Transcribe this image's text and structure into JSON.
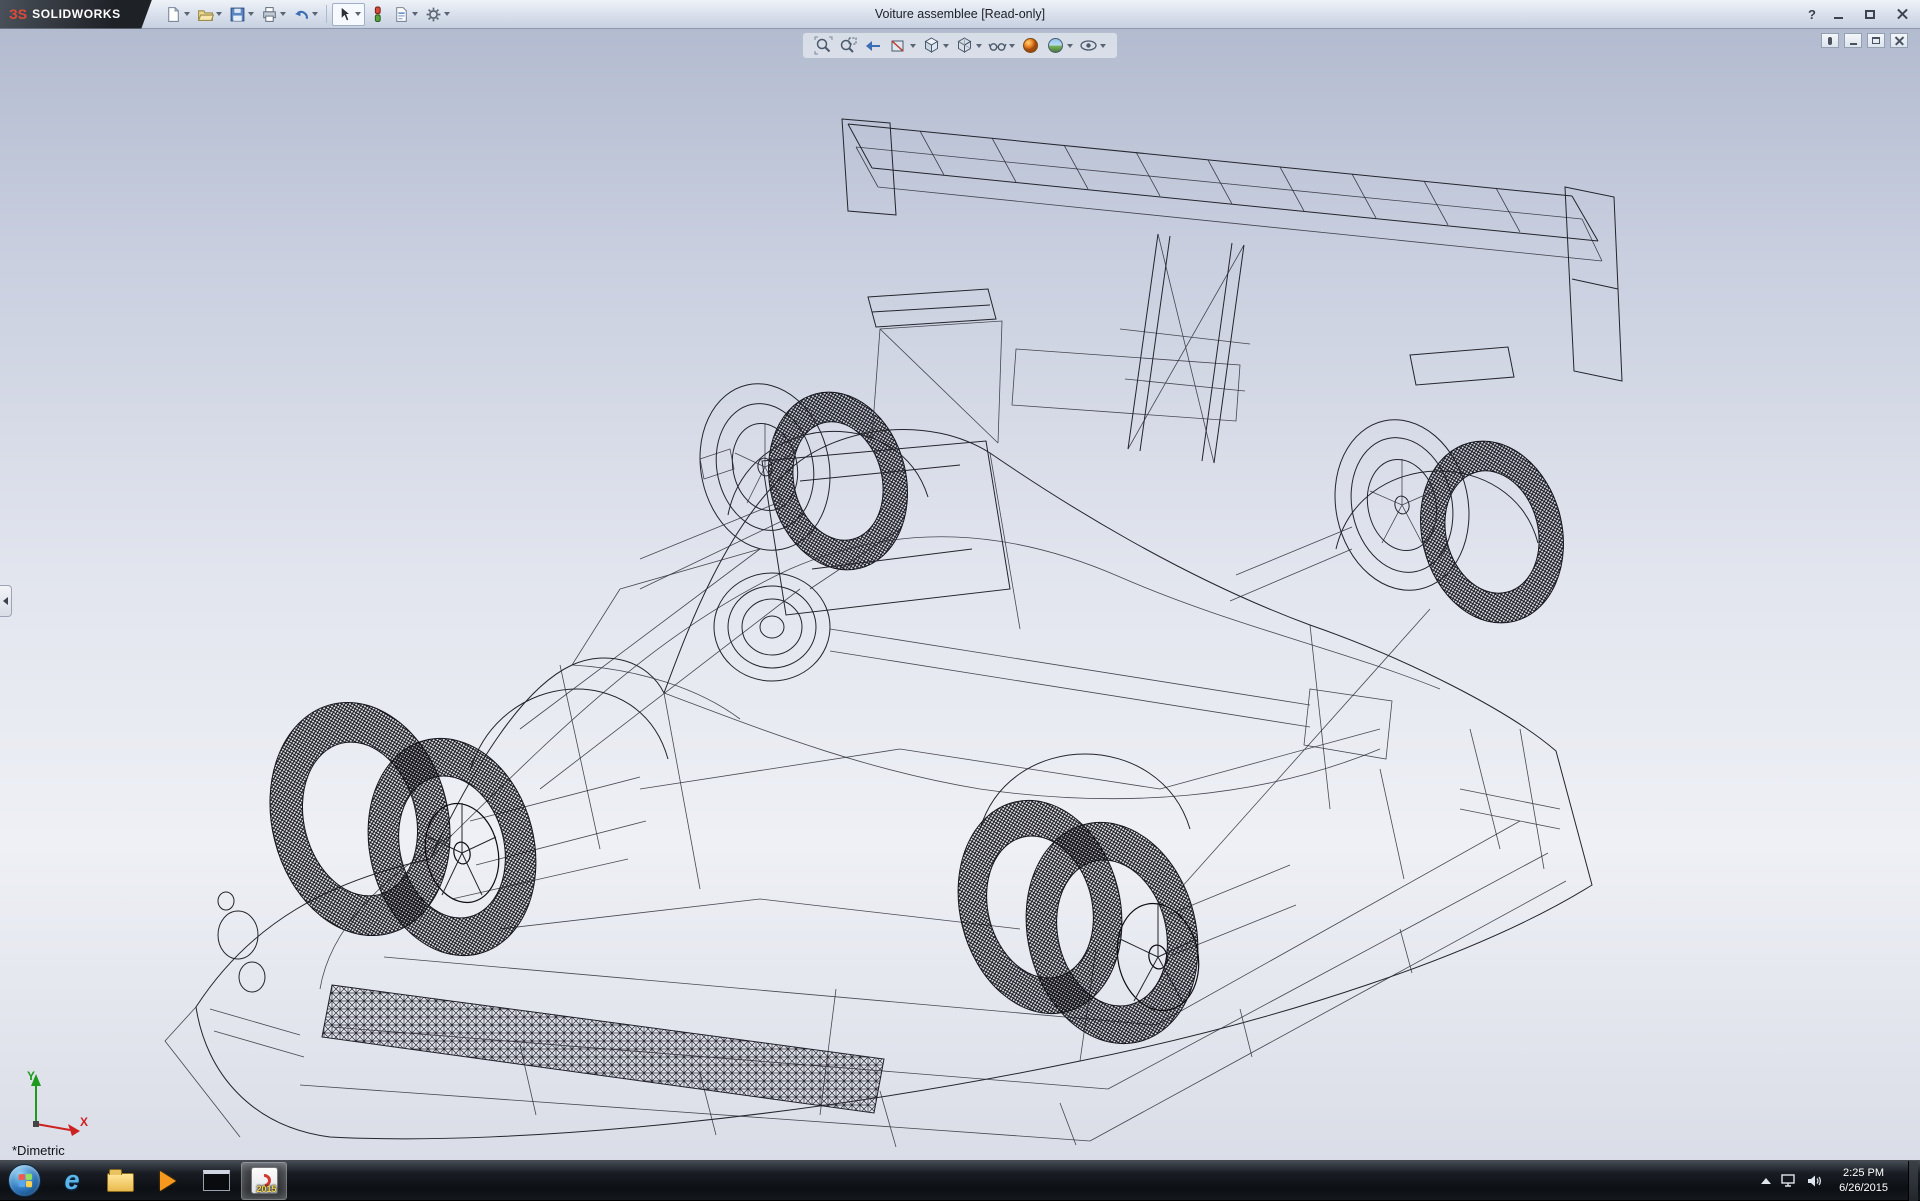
{
  "window": {
    "brand_mark": "ЗS",
    "brand": "SOLIDWORKS",
    "title": "Voiture assemblee [Read-only]",
    "help_label": "?",
    "controls": [
      "minimize",
      "maximize",
      "close"
    ]
  },
  "main_toolbar": {
    "items": [
      {
        "name": "new-document",
        "dropdown": true
      },
      {
        "name": "open-document",
        "dropdown": true
      },
      {
        "name": "save",
        "dropdown": true
      },
      {
        "name": "print",
        "dropdown": true
      },
      {
        "name": "undo",
        "dropdown": true
      },
      {
        "name": "select",
        "dropdown": true,
        "pressed": true
      },
      {
        "name": "rebuild",
        "dropdown": false
      },
      {
        "name": "file-properties",
        "dropdown": true
      },
      {
        "name": "options",
        "dropdown": true
      }
    ]
  },
  "viewport": {
    "view_label": "*Dimetric",
    "triad": {
      "x": "X",
      "y": "Y"
    },
    "headsup_items": [
      "zoom-to-fit",
      "zoom-to-area",
      "previous-view",
      "section-view",
      "view-orientation",
      "display-style",
      "hide-show-items",
      "edit-appearance",
      "apply-scene",
      "view-settings"
    ],
    "child_window_controls": [
      "pin",
      "minimize",
      "restore",
      "close"
    ],
    "model": "wireframe race car assembly, dimetric view"
  },
  "taskbar": {
    "items": [
      {
        "name": "start"
      },
      {
        "name": "internet-explorer"
      },
      {
        "name": "windows-explorer"
      },
      {
        "name": "media-player"
      },
      {
        "name": "command-prompt"
      },
      {
        "name": "solidworks-2015",
        "badge": "2015",
        "active": true
      }
    ],
    "tray": {
      "time": "2:25 PM",
      "date": "6/26/2015"
    }
  },
  "colors": {
    "viewport_top": "#b3bbd0",
    "viewport_mid": "#eef0f5",
    "viewport_bottom": "#dadde7",
    "titlebar": "#d9e0ec",
    "taskbar": "#14181d",
    "accent_red": "#d23b2f",
    "accent_blue": "#3c6eb5",
    "badge_yellow": "#f3d54a"
  }
}
